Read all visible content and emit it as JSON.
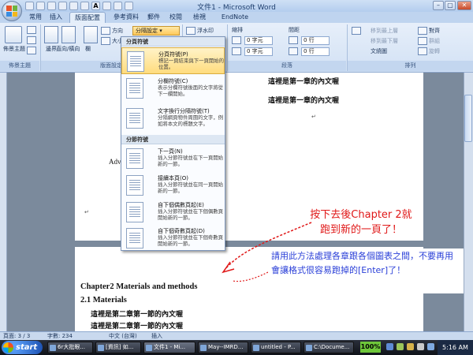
{
  "window": {
    "title": "文件1 - Microsoft Word",
    "minimize": "–",
    "maximize": "▢",
    "close": "✕"
  },
  "tabs": [
    "常用",
    "插入",
    "版面配置",
    "參考資料",
    "郵件",
    "校閱",
    "檢視",
    "EndNote"
  ],
  "ribbon": {
    "themes_label": "佈景主題",
    "themes_group": "佈景主題",
    "margins_label": "邊界",
    "orientation_label": "直向/橫向",
    "columns_label": "欄",
    "direction_label": "方向",
    "size_label": "大小",
    "page_setup_dropdown": "分隔設定",
    "page_setup_group": "版面設定",
    "watermark_label": "浮水印",
    "indent_label": "縮排",
    "spacing_label": "間距",
    "indent_left": "0 字元",
    "indent_right": "0 字元",
    "spacing_before": "0 行",
    "spacing_after": "0 行",
    "paragraph_group": "段落",
    "bring_front": "移到最上層",
    "send_back": "移到最下層",
    "text_wrap": "文繞圖",
    "align": "對齊",
    "group": "群組",
    "rotate": "旋轉",
    "arrange_group": "排列"
  },
  "menu": {
    "section_page": "分頁符號",
    "section_section": "分節符號",
    "items": [
      {
        "title": "分頁符號(P)",
        "desc": "標記一頁結束與下一頁開始的位置。"
      },
      {
        "title": "分欄符號(C)",
        "desc": "表示分欄符號後面的文字將從下一欄開始。"
      },
      {
        "title": "文字換行分隔符號(T)",
        "desc": "分隔網頁物件周圍的文字，例如將本文的標題文字。"
      },
      {
        "title": "下一頁(N)",
        "desc": "插入分節符號並在下一頁開始新的一節。"
      },
      {
        "title": "接續本頁(O)",
        "desc": "插入分節符號並在同一頁開始新的一節。"
      },
      {
        "title": "自下個偶數頁起(E)",
        "desc": "插入分節符號並在下個偶數頁開始新的一節。"
      },
      {
        "title": "自下個奇數頁起(D)",
        "desc": "插入分節符號並在下個奇數頁開始新的一節。"
      }
    ]
  },
  "document": {
    "page1_line1": "這裡是第一章的內文喔",
    "page1_line2": "這裡是第一章的內文喔",
    "page1_partial": "Adv",
    "chapter2_heading": "Chapter2 Materials and methods",
    "section_heading": "2.1 Materials",
    "page2_line1": "這裡是第二章第一節的內文喔",
    "page2_line2": "這裡是第二章第一節的內文喔",
    "para_mark": "↵"
  },
  "annotations": {
    "note1_line1": "按下去後Chapter 2就",
    "note1_line2": "跑到新的一頁了！",
    "note2": "請用此方法處理各章跟各個圖表之間，不要再用會讓格式很容易跑掉的[Enter]了！"
  },
  "statusbar": {
    "page": "頁面: 3 / 3",
    "words": "字數: 234",
    "language": "中文 (台灣)",
    "insert": "插入"
  },
  "taskbar": {
    "start": "start",
    "tasks": [
      "6r大批眼...",
      "[資訊] 如...",
      "文件1 - Mi...",
      "May--IMRD...",
      "untitled - P...",
      "C:\\Docume..."
    ],
    "zoom": "100%",
    "clock": "5:16 AM"
  },
  "colors": {
    "accent": "#ffc95a",
    "annotation_red": "#e01818",
    "annotation_blue": "#2a3fd8"
  }
}
